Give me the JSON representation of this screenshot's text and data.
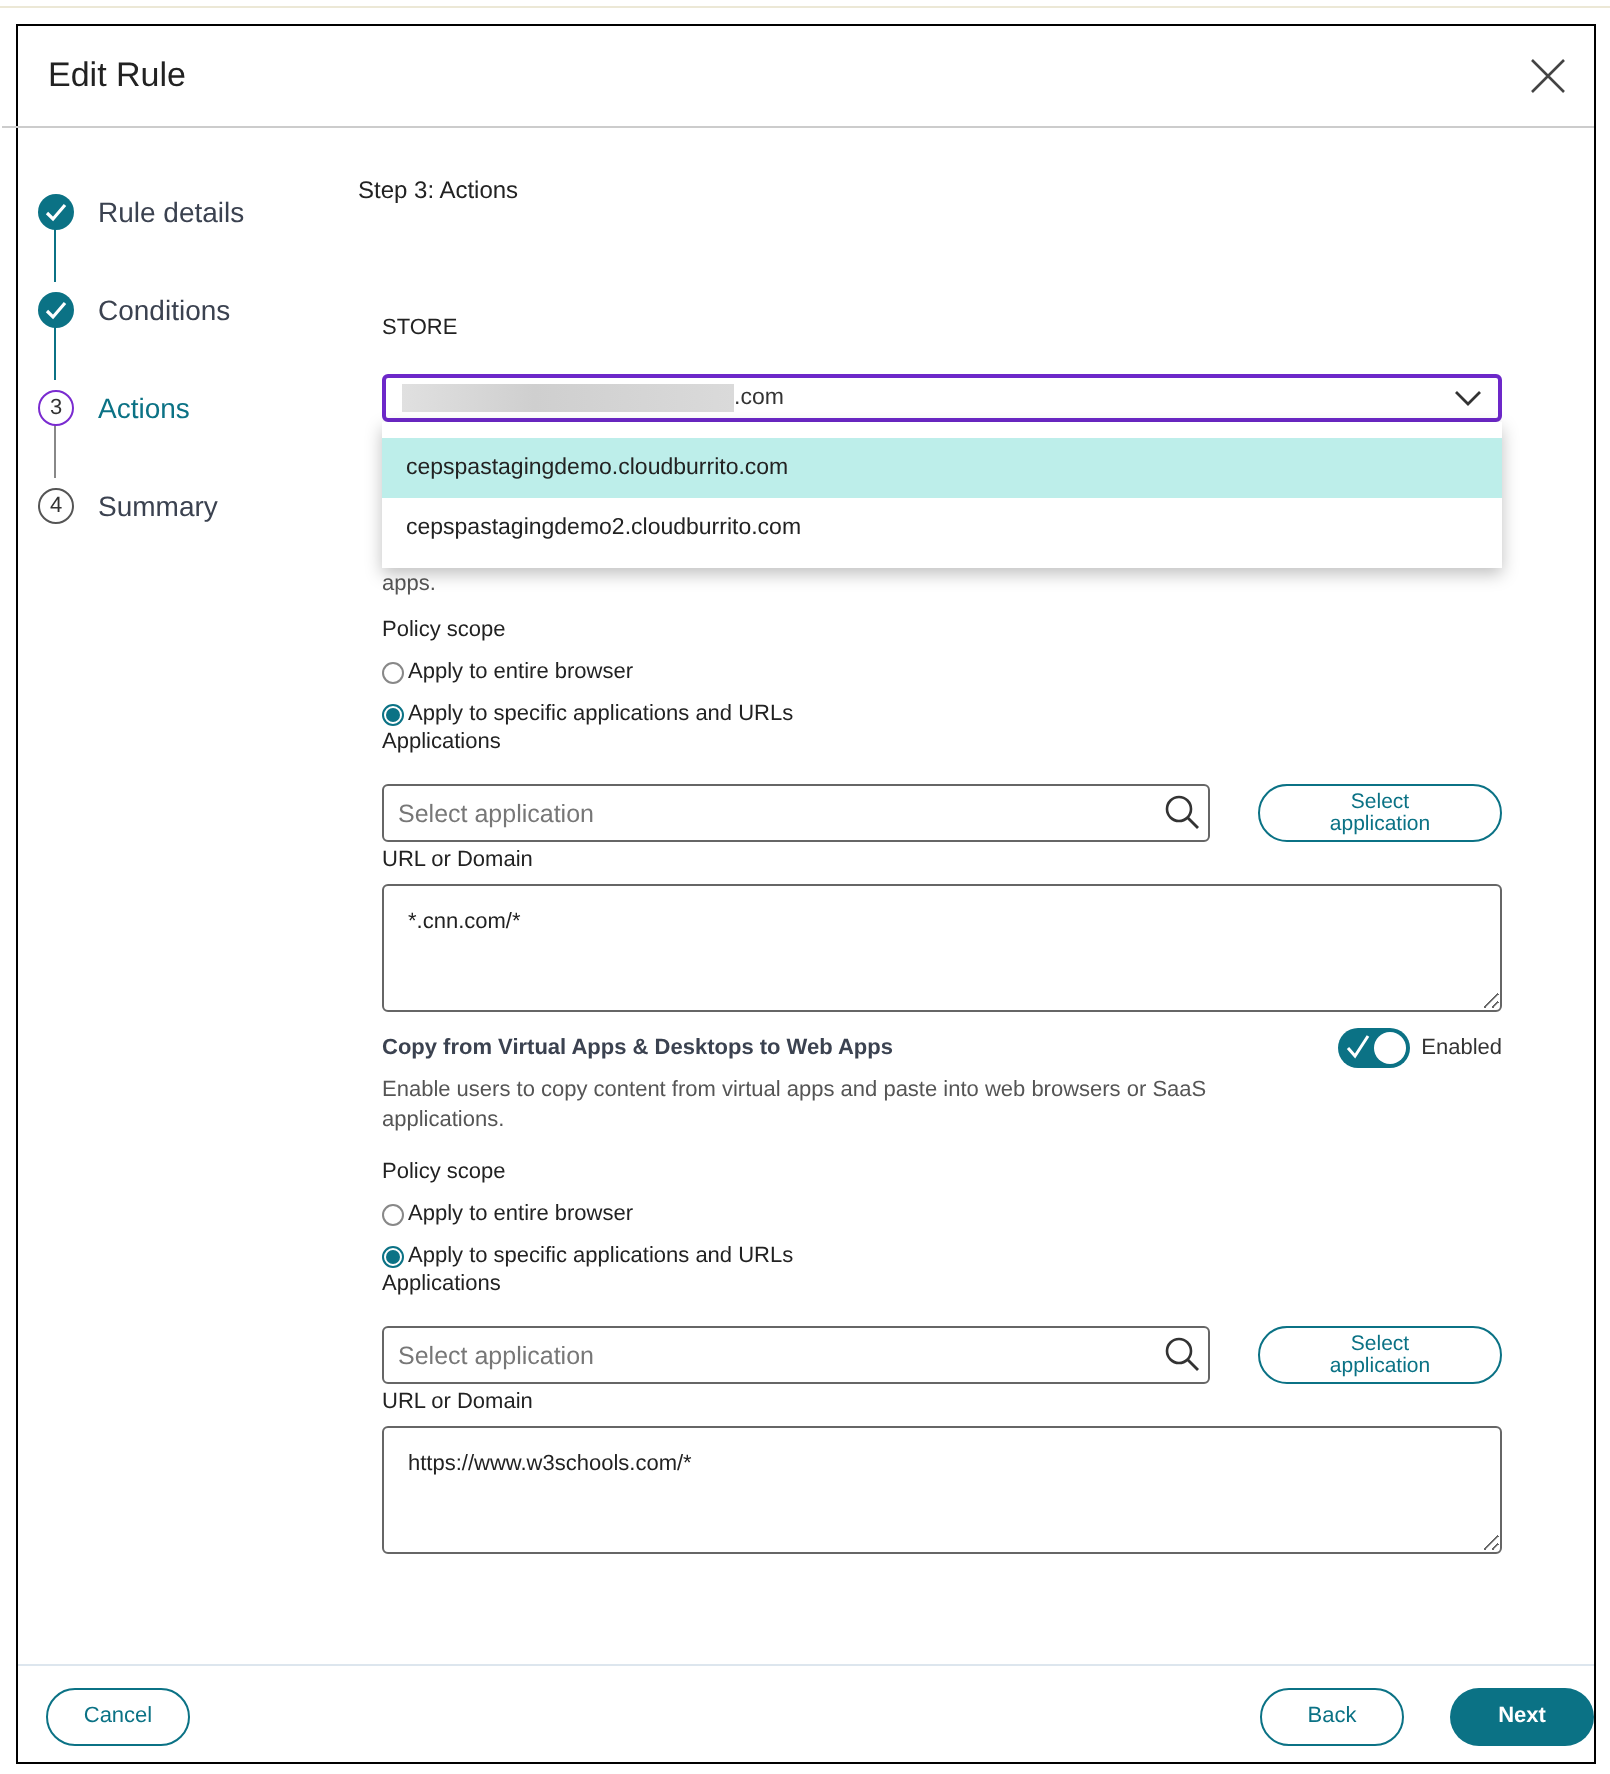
{
  "window": {
    "title": "Edit Rule"
  },
  "steps": [
    {
      "label": "Rule details",
      "done": true,
      "selected": false
    },
    {
      "label": "Conditions",
      "done": true,
      "selected": false
    },
    {
      "label": "Actions",
      "done": false,
      "selected": true,
      "number": "3"
    },
    {
      "label": "Summary",
      "done": false,
      "selected": false,
      "number": "4"
    }
  ],
  "step_heading": "Step 3: Actions",
  "store": {
    "label": "STORE",
    "value": ".com",
    "expanded": true,
    "options": [
      {
        "label": "cepspastagingdemo.cloudburrito.com",
        "selected": true
      },
      {
        "label": "cepspastagingdemo2.cloudburrito.com",
        "selected": false
      }
    ]
  },
  "covered_text": "apps.",
  "sections": [
    {
      "policy_scope_label": "Policy scope",
      "scope_options": [
        {
          "label": "Apply to entire browser",
          "selected": false
        },
        {
          "label": "Apply to specific applications and URLs",
          "selected": true
        }
      ],
      "applications_label": "Applications",
      "application_placeholder": "Select application",
      "select_button": "Select application",
      "url_label": "URL or Domain",
      "url_value": "*.cnn.com/*"
    },
    {
      "title": "Copy from Virtual Apps & Desktops to Web Apps",
      "description": "Enable users to copy content from virtual apps and paste into web browsers or SaaS applications.",
      "toggle": {
        "on": true,
        "label": "Enabled"
      },
      "policy_scope_label": "Policy scope",
      "scope_options": [
        {
          "label": "Apply to entire browser",
          "selected": false
        },
        {
          "label": "Apply to specific applications and URLs",
          "selected": true
        }
      ],
      "applications_label": "Applications",
      "application_placeholder": "Select application",
      "select_button": "Select application",
      "url_label": "URL or Domain",
      "url_value": "https://www.w3schools.com/*"
    }
  ],
  "footer": {
    "cancel": "Cancel",
    "back": "Back",
    "next": "Next"
  }
}
